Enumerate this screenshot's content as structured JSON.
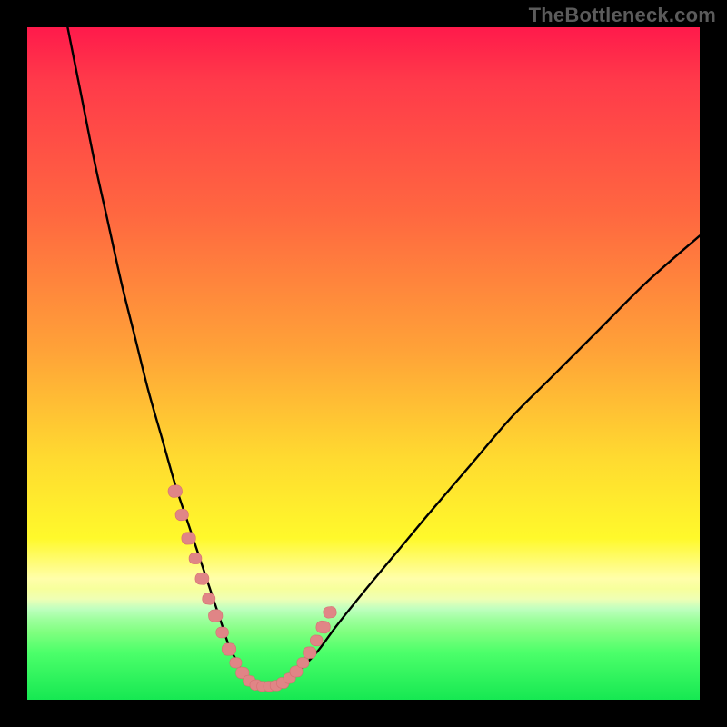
{
  "watermark": "TheBottleneck.com",
  "colors": {
    "frame": "#000000",
    "curve": "#000000",
    "marker_fill": "#e08586",
    "marker_stroke": "#d66f72"
  },
  "chart_data": {
    "type": "line",
    "title": "",
    "xlabel": "",
    "ylabel": "",
    "xlim": [
      0,
      100
    ],
    "ylim": [
      0,
      100
    ],
    "series": [
      {
        "name": "bottleneck-curve",
        "x": [
          6,
          8,
          10,
          12,
          14,
          16,
          18,
          20,
          22,
          24,
          26,
          28,
          29,
          30,
          31,
          32,
          33,
          34,
          36,
          38,
          40,
          43,
          46,
          50,
          55,
          60,
          66,
          72,
          78,
          85,
          92,
          100
        ],
        "y": [
          100,
          90,
          80,
          71,
          62,
          54,
          46,
          39,
          32,
          26,
          20,
          14,
          11,
          8,
          6,
          4,
          2.5,
          2,
          2,
          2.5,
          4,
          7,
          11,
          16,
          22,
          28,
          35,
          42,
          48,
          55,
          62,
          69
        ]
      }
    ],
    "markers": {
      "name": "highlight-dots",
      "x": [
        22,
        23,
        24,
        25,
        26,
        27,
        28,
        29,
        30,
        31,
        32,
        33,
        34,
        35,
        36,
        37,
        38,
        39,
        40,
        41,
        42,
        43,
        44,
        45
      ],
      "y": [
        31,
        27.5,
        24,
        21,
        18,
        15,
        12.5,
        10,
        7.5,
        5.5,
        4,
        2.8,
        2.2,
        2,
        2,
        2.1,
        2.5,
        3.2,
        4.2,
        5.5,
        7,
        8.8,
        10.8,
        13
      ],
      "r": [
        7,
        6.5,
        7,
        6.3,
        6.8,
        6.4,
        7,
        6.2,
        7,
        6,
        6.6,
        6.2,
        6,
        5.8,
        5.8,
        6,
        6.2,
        6,
        6.4,
        6,
        6.6,
        6.2,
        7,
        6.5
      ]
    },
    "gradient_stops": [
      {
        "pos": 0,
        "color": "#ff1a4b"
      },
      {
        "pos": 28,
        "color": "#ff6840"
      },
      {
        "pos": 64,
        "color": "#ffda30"
      },
      {
        "pos": 83,
        "color": "#fffeaa"
      },
      {
        "pos": 93,
        "color": "#4cff6a"
      },
      {
        "pos": 100,
        "color": "#16e852"
      }
    ]
  }
}
